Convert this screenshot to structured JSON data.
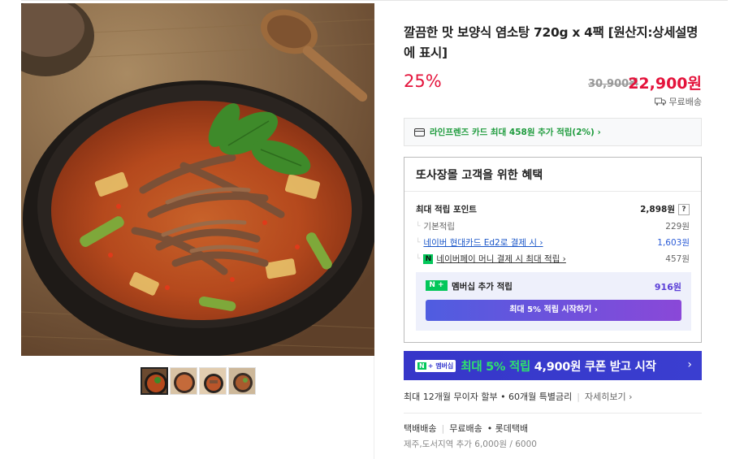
{
  "product": {
    "title": "깔끔한 맛 보양식 염소탕 720g x 4팩 [원산지:상세설명에 표시]",
    "discount": "25%",
    "original_price": "30,900원",
    "sale_price": "22,900원",
    "shipping_badge": "무료배송"
  },
  "gallery": {
    "thumbnails": [
      "thumb-1",
      "thumb-2",
      "thumb-3",
      "thumb-4"
    ]
  },
  "card_banner": "라인프렌즈 카드 최대 458원 추가 적립(2%) ›",
  "benefits": {
    "title": "또사장몰 고객을 위한 혜택",
    "max_point_label": "최대 적립 포인트",
    "max_point_value": "2,898원",
    "help": "?",
    "rows": [
      {
        "label": "기본적립",
        "value": "229원"
      },
      {
        "label": "네이버 현대카드 Ed2로 결제 시 ›",
        "value": "1,603원"
      },
      {
        "label": "네이버페이 머니 결제 시 최대 적립 ›",
        "value": "457원"
      }
    ],
    "npay_icon": "N",
    "membership": {
      "badge": "N +",
      "label": "멤버십 추가 적립",
      "value": "916원",
      "button": "최대 5% 적립 시작하기 ›"
    }
  },
  "coupon_banner": {
    "badge_n": "N",
    "badge_text": "+ 멤버십",
    "text_green": "최대 5% 적립",
    "text_white": "4,900원 쿠폰 받고 시작",
    "chevron": "›"
  },
  "installment": {
    "text": "최대 12개월 무이자 할부 • 60개월 특별금리",
    "sep": "|",
    "link": "자세히보기 ›"
  },
  "delivery": {
    "method": "택배배송",
    "sep": "|",
    "fee": "무료배송",
    "carrier": "• 롯데택배",
    "extra": "제주,도서지역 추가 6,000원 / 6000"
  },
  "colors": {
    "accent_red": "#e4133b",
    "naver_green": "#03c75a",
    "membership_purple": "#5b3fd7",
    "coupon_blue": "#3636c9"
  },
  "icons": [
    "truck-icon",
    "credit-card-icon",
    "question-icon",
    "naver-pay-icon",
    "naver-plus-icon",
    "chevron-right-icon"
  ]
}
